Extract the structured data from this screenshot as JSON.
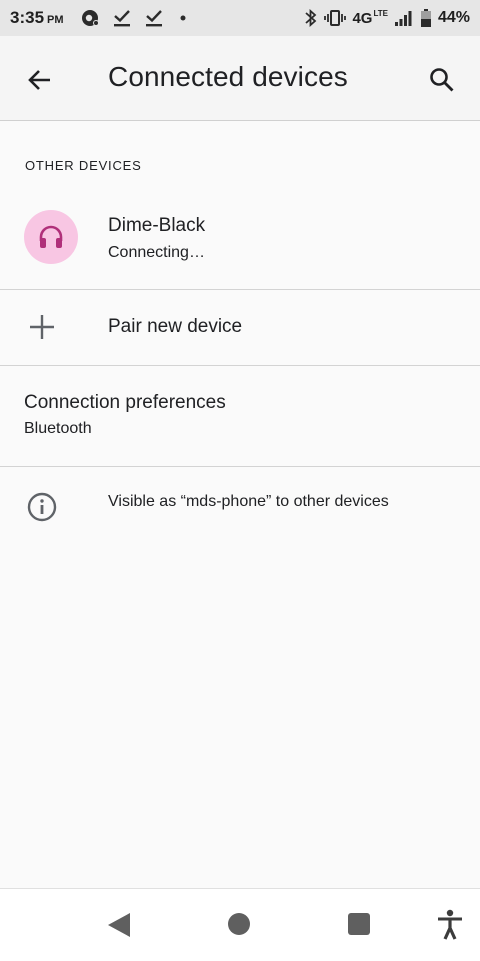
{
  "status_bar": {
    "time": "3:35",
    "ampm": "PM",
    "network": "4G",
    "network_sub": "LTE",
    "battery_percent": "44%"
  },
  "app_bar": {
    "title": "Connected devices",
    "icons": {
      "back": "arrow-back-icon",
      "search": "search-icon"
    }
  },
  "other_devices": {
    "header": "OTHER DEVICES",
    "devices": [
      {
        "name": "Dime-Black",
        "status": "Connecting…",
        "icon": "headset-icon",
        "icon_bg": "#f8c6e3",
        "icon_color": "#b0307a"
      }
    ]
  },
  "pair_new": {
    "label": "Pair new device",
    "icon": "plus-icon"
  },
  "connection_preferences": {
    "title": "Connection preferences",
    "subtitle": "Bluetooth"
  },
  "visibility_info": {
    "text": "Visible as “mds-phone” to other devices",
    "icon": "info-icon"
  },
  "nav_bar": {
    "icons": [
      "nav-back-icon",
      "nav-home-icon",
      "nav-recents-icon",
      "accessibility-icon"
    ]
  }
}
